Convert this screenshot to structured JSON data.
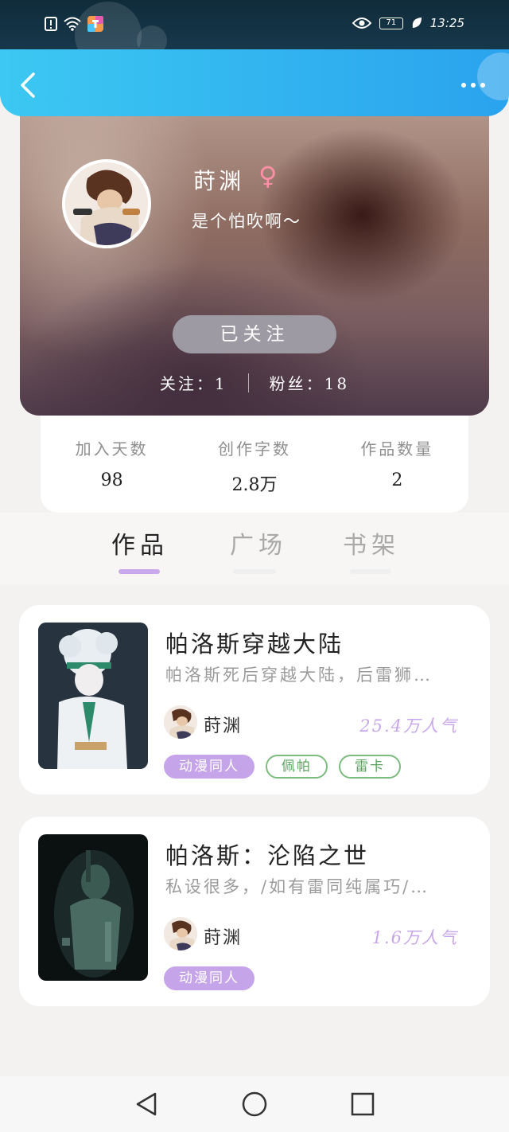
{
  "status_bar": {
    "time": "13:25",
    "battery": "71"
  },
  "header": {
    "back_icon": "chevron-left-icon",
    "more_icon": "more-dots-icon"
  },
  "profile": {
    "name": "莳渊",
    "gender_symbol": "♀",
    "bio": "是个怕吹啊～",
    "follow_button": "已关注",
    "following_label": "关注：",
    "following_count": "1",
    "fans_label": "粉丝：",
    "fans_count": "18"
  },
  "stats": [
    {
      "label": "加入天数",
      "value": "98"
    },
    {
      "label": "创作字数",
      "value": "2.8万"
    },
    {
      "label": "作品数量",
      "value": "2"
    }
  ],
  "tabs": [
    {
      "label": "作品",
      "active": true
    },
    {
      "label": "广场",
      "active": false
    },
    {
      "label": "书架",
      "active": false
    }
  ],
  "books": [
    {
      "title": "帕洛斯穿越大陆",
      "description": "帕洛斯死后穿越大陆，后雷狮…",
      "author": "莳渊",
      "popularity": "25.4万人气",
      "tags": [
        "动漫同人",
        "佩帕",
        "雷卡"
      ]
    },
    {
      "title": "帕洛斯：沦陷之世",
      "description": "私设很多，/如有雷同纯属巧/…",
      "author": "莳渊",
      "popularity": "1.6万人气",
      "tags": [
        "动漫同人"
      ]
    }
  ],
  "colors": {
    "header": "#2aa3ee",
    "accent_purple": "#c6a4ea",
    "tag_green": "#7cbc7e",
    "gender_pink": "#ff8fa6"
  }
}
